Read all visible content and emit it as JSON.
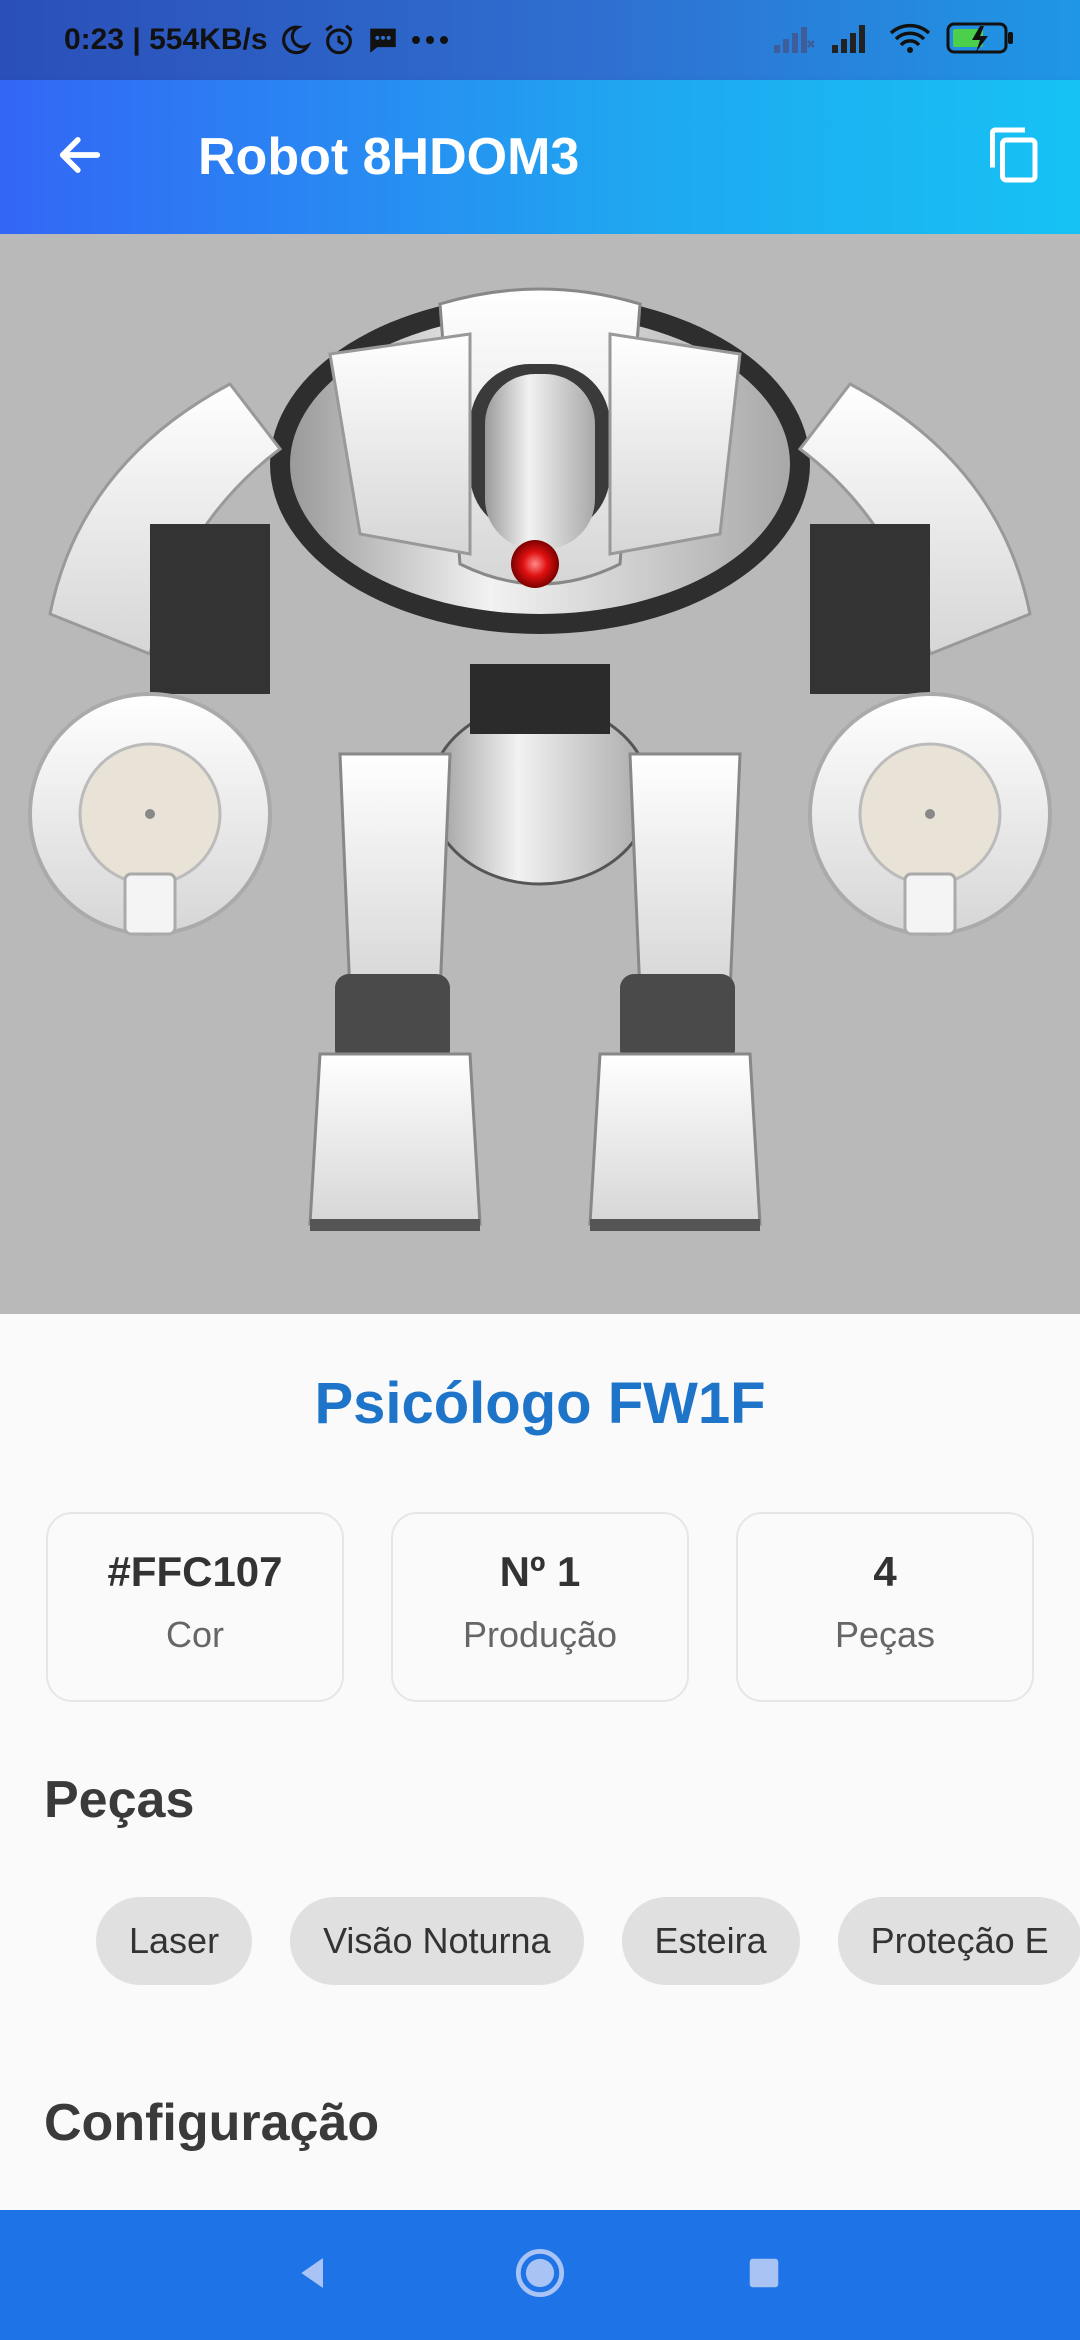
{
  "status_bar": {
    "time_speed": "0:23 | 554KB/s",
    "icons": [
      "moon-icon",
      "alarm-icon",
      "message-icon",
      "more-dots-icon",
      "signal-icon",
      "signal-icon",
      "wifi-icon",
      "battery-charging-icon"
    ]
  },
  "app_bar": {
    "title": "Robot 8HDOM3",
    "back_icon": "arrow-left-icon",
    "copy_icon": "copy-icon",
    "gradient_start": "#3366f5",
    "gradient_end": "#16c2f4"
  },
  "robot": {
    "name": "Psicólogo FW1F",
    "name_color": "#1e74c8",
    "image_background": "#b9b9b9"
  },
  "stats": [
    {
      "value": "#FFC107",
      "label": "Cor"
    },
    {
      "value": "Nº 1",
      "label": "Produção"
    },
    {
      "value": "4",
      "label": "Peças"
    }
  ],
  "parts_section": {
    "title": "Peças",
    "chips": [
      "Laser",
      "Visão Noturna",
      "Esteira",
      "Proteção E"
    ]
  },
  "config_section": {
    "title": "Configuração"
  },
  "nav_bar": {
    "color": "#1e74e6",
    "icons": [
      "back-triangle-icon",
      "home-circle-icon",
      "recents-square-icon"
    ]
  }
}
